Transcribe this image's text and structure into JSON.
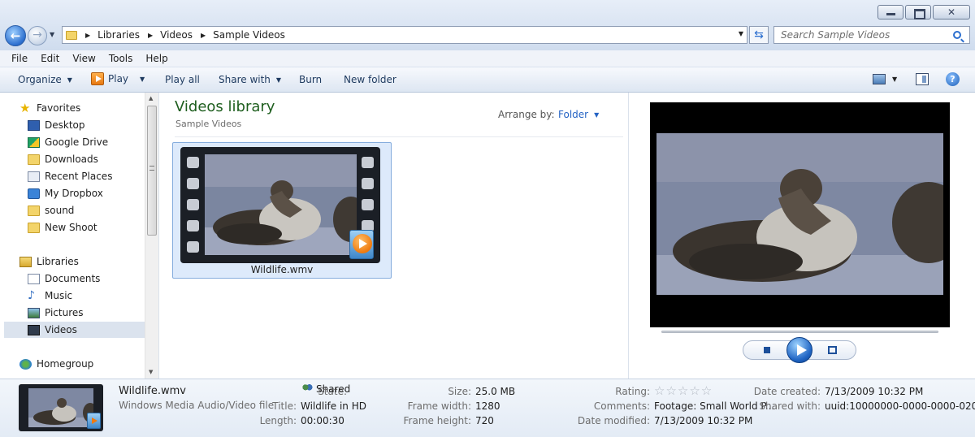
{
  "window": {
    "controls": [
      "minimize",
      "maximize",
      "close"
    ]
  },
  "address": {
    "breadcrumbs": [
      "Libraries",
      "Videos",
      "Sample Videos"
    ]
  },
  "search": {
    "placeholder": "Search Sample Videos"
  },
  "menu": [
    "File",
    "Edit",
    "View",
    "Tools",
    "Help"
  ],
  "commands": {
    "organize": "Organize",
    "play": "Play",
    "play_all": "Play all",
    "share_with": "Share with",
    "burn": "Burn",
    "new_folder": "New folder"
  },
  "nav": {
    "favorites": {
      "label": "Favorites",
      "items": [
        "Desktop",
        "Google Drive",
        "Downloads",
        "Recent Places",
        "My Dropbox",
        "sound",
        "New Shoot"
      ]
    },
    "libraries": {
      "label": "Libraries",
      "items": [
        "Documents",
        "Music",
        "Pictures",
        "Videos"
      ],
      "selected": "Videos"
    },
    "homegroup": "Homegroup"
  },
  "library": {
    "title": "Videos library",
    "subtitle": "Sample Videos",
    "arrange_label": "Arrange by:",
    "arrange_value": "Folder"
  },
  "files": [
    {
      "name": "Wildlife.wmv"
    }
  ],
  "details": {
    "name": "Wildlife.wmv",
    "type": "Windows Media Audio/Video file",
    "labels": {
      "state": "State:",
      "title": "Title:",
      "length": "Length:",
      "size": "Size:",
      "frame_width": "Frame width:",
      "frame_height": "Frame height:",
      "rating": "Rating:",
      "comments": "Comments:",
      "date_modified": "Date modified:",
      "date_created": "Date created:",
      "shared_with": "Shared with:"
    },
    "values": {
      "state": "Shared",
      "title": "Wildlife in HD",
      "length": "00:00:30",
      "size": "25.0 MB",
      "frame_width": "1280",
      "frame_height": "720",
      "rating_stars": "☆☆☆☆☆",
      "comments": "Footage: Small World P...",
      "date_modified": "7/13/2009 10:32 PM",
      "date_created": "7/13/2009 10:32 PM",
      "shared_with": "uuid:10000000-0000-0000-020..."
    }
  }
}
